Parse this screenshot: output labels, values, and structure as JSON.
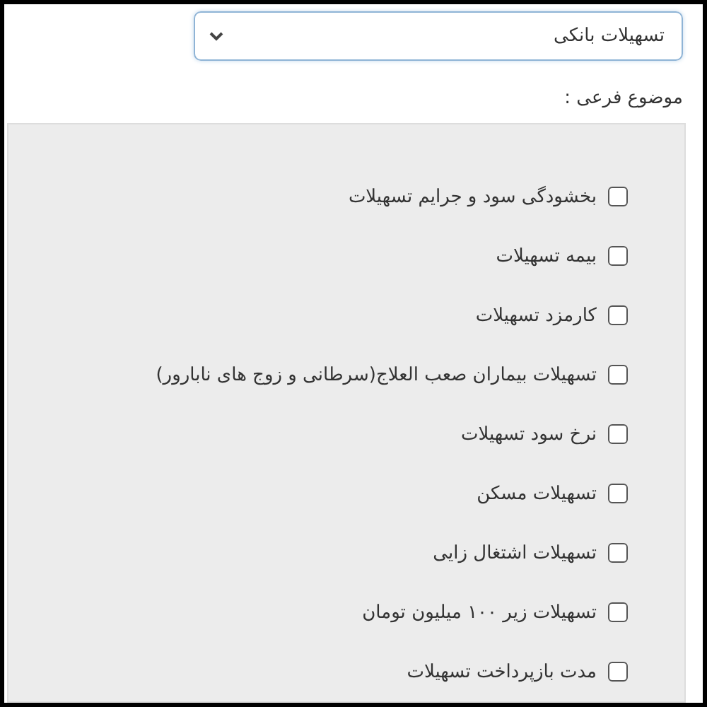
{
  "select": {
    "value": "تسهیلات بانکی"
  },
  "subtopic_label": "موضوع فرعی :",
  "options": [
    {
      "label": "بخشودگی سود و جرایم تسهیلات",
      "checked": false
    },
    {
      "label": "بیمه تسهیلات",
      "checked": false
    },
    {
      "label": "کارمزد تسهیلات",
      "checked": false
    },
    {
      "label": "تسهیلات بیماران صعب العلاج(سرطانی و زوج های نابارور)",
      "checked": false
    },
    {
      "label": "نرخ سود تسهیلات",
      "checked": false
    },
    {
      "label": "تسهیلات مسکن",
      "checked": false
    },
    {
      "label": "تسهیلات اشتغال زایی",
      "checked": false
    },
    {
      "label": "تسهیلات زیر ۱۰۰ میلیون تومان",
      "checked": false
    },
    {
      "label": "مدت بازپرداخت تسهیلات",
      "checked": false
    }
  ]
}
